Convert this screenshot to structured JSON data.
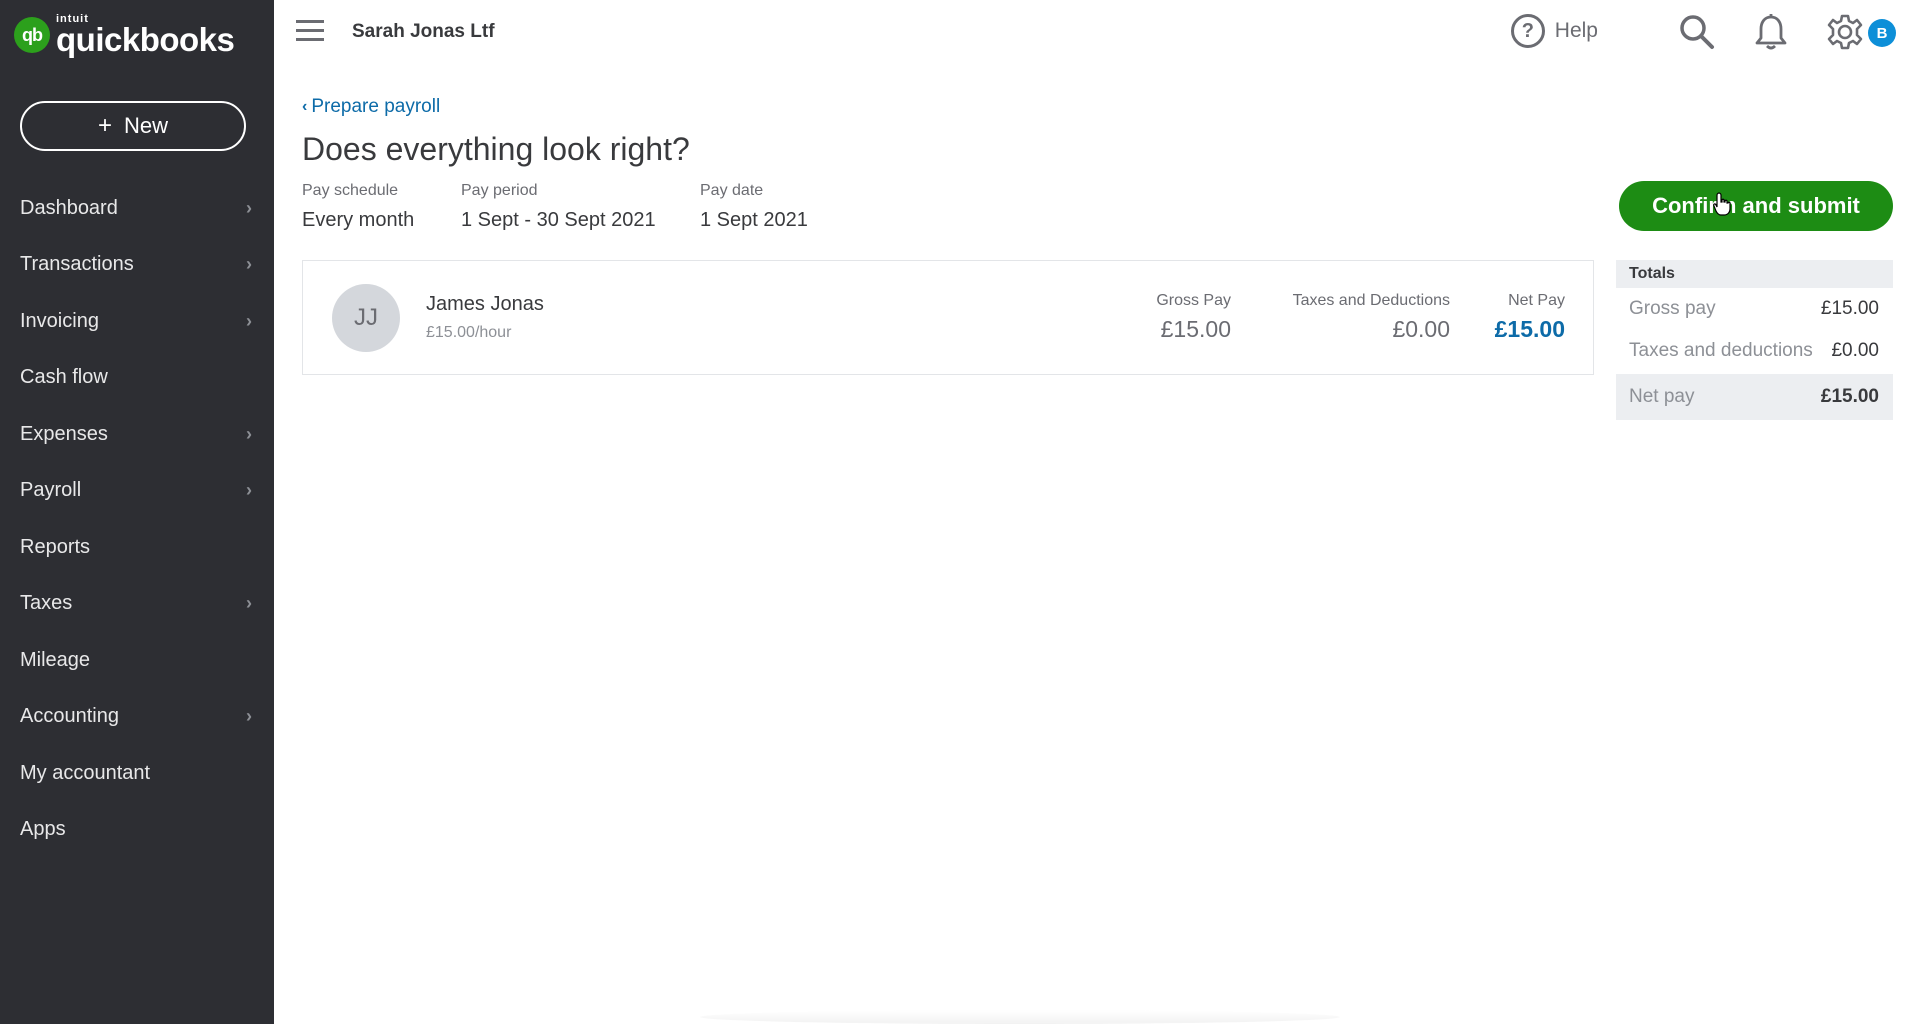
{
  "sidebar": {
    "logo": {
      "badge": "qb",
      "brand_top": "intuit",
      "brand_name": "quickbooks"
    },
    "new_button": {
      "icon": "plus-icon",
      "label": "New"
    },
    "items": [
      {
        "label": "Dashboard",
        "has_submenu": true
      },
      {
        "label": "Transactions",
        "has_submenu": true
      },
      {
        "label": "Invoicing",
        "has_submenu": true
      },
      {
        "label": "Cash flow",
        "has_submenu": false
      },
      {
        "label": "Expenses",
        "has_submenu": true
      },
      {
        "label": "Payroll",
        "has_submenu": true
      },
      {
        "label": "Reports",
        "has_submenu": false
      },
      {
        "label": "Taxes",
        "has_submenu": true
      },
      {
        "label": "Mileage",
        "has_submenu": false
      },
      {
        "label": "Accounting",
        "has_submenu": true
      },
      {
        "label": "My accountant",
        "has_submenu": false
      },
      {
        "label": "Apps",
        "has_submenu": false
      }
    ]
  },
  "header": {
    "company_name": "Sarah Jonas Ltf",
    "help_label": "Help",
    "avatar_initial": "B",
    "icons": [
      "menu-icon",
      "help-icon",
      "search-icon",
      "bell-icon",
      "gear-icon"
    ]
  },
  "page": {
    "back_link": "Prepare payroll",
    "title": "Does everything look right?",
    "meta": {
      "pay_schedule": {
        "label": "Pay schedule",
        "value": "Every month"
      },
      "pay_period": {
        "label": "Pay period",
        "value": "1 Sept - 30 Sept 2021"
      },
      "pay_date": {
        "label": "Pay date",
        "value": "1 Sept 2021"
      }
    },
    "confirm_button": "Confirm and submit"
  },
  "employee": {
    "initials": "JJ",
    "name": "James Jonas",
    "rate": "£15.00/hour",
    "gross_pay_label": "Gross Pay",
    "gross_pay": "£15.00",
    "taxes_label": "Taxes and Deductions",
    "taxes": "£0.00",
    "net_pay_label": "Net Pay",
    "net_pay": "£15.00"
  },
  "totals": {
    "heading": "Totals",
    "gross_label": "Gross pay",
    "gross": "£15.00",
    "taxes_label": "Taxes and deductions",
    "taxes": "£0.00",
    "net_label": "Net pay",
    "net": "£15.00"
  },
  "colors": {
    "sidebar_bg": "#2d2e33",
    "brand_green": "#2ca01c",
    "button_green": "#1d8c14",
    "link_blue": "#0d6ba8",
    "avatar_blue": "#0d8fd8"
  }
}
